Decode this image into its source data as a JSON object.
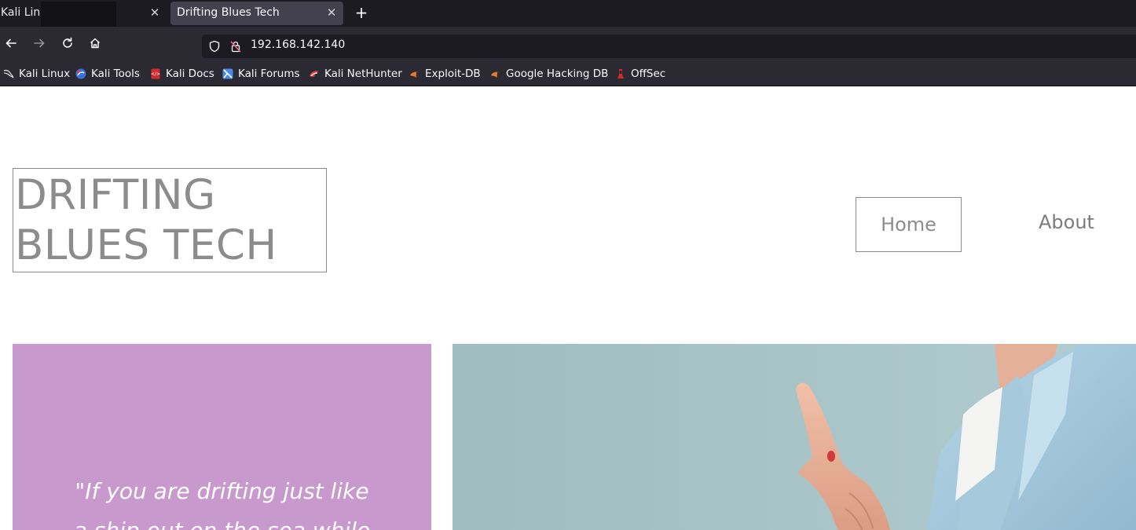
{
  "tabs": [
    {
      "title": "Kali Linux",
      "active": false
    },
    {
      "title": "Drifting Blues Tech",
      "active": true
    }
  ],
  "address": {
    "url": "192.168.142.140"
  },
  "bookmarks": [
    {
      "label": "Kali Linux",
      "icon": "kali-dragon-icon"
    },
    {
      "label": "Kali Tools",
      "icon": "kali-tools-icon"
    },
    {
      "label": "Kali Docs",
      "icon": "kali-docs-icon"
    },
    {
      "label": "Kali Forums",
      "icon": "kali-forums-icon"
    },
    {
      "label": "Kali NetHunter",
      "icon": "nethunter-icon"
    },
    {
      "label": "Exploit-DB",
      "icon": "exploit-db-icon"
    },
    {
      "label": "Google Hacking DB",
      "icon": "ghdb-icon"
    },
    {
      "label": "OffSec",
      "icon": "offsec-icon"
    }
  ],
  "site": {
    "logo": "DRIFTING\nBLUES TECH",
    "nav": {
      "home": "Home",
      "about": "About"
    },
    "quote": "\"If you are drifting just like a ship out on the sea while"
  },
  "colors": {
    "quote_panel": "#c899cc",
    "photo_background": "#a8c3c6"
  }
}
